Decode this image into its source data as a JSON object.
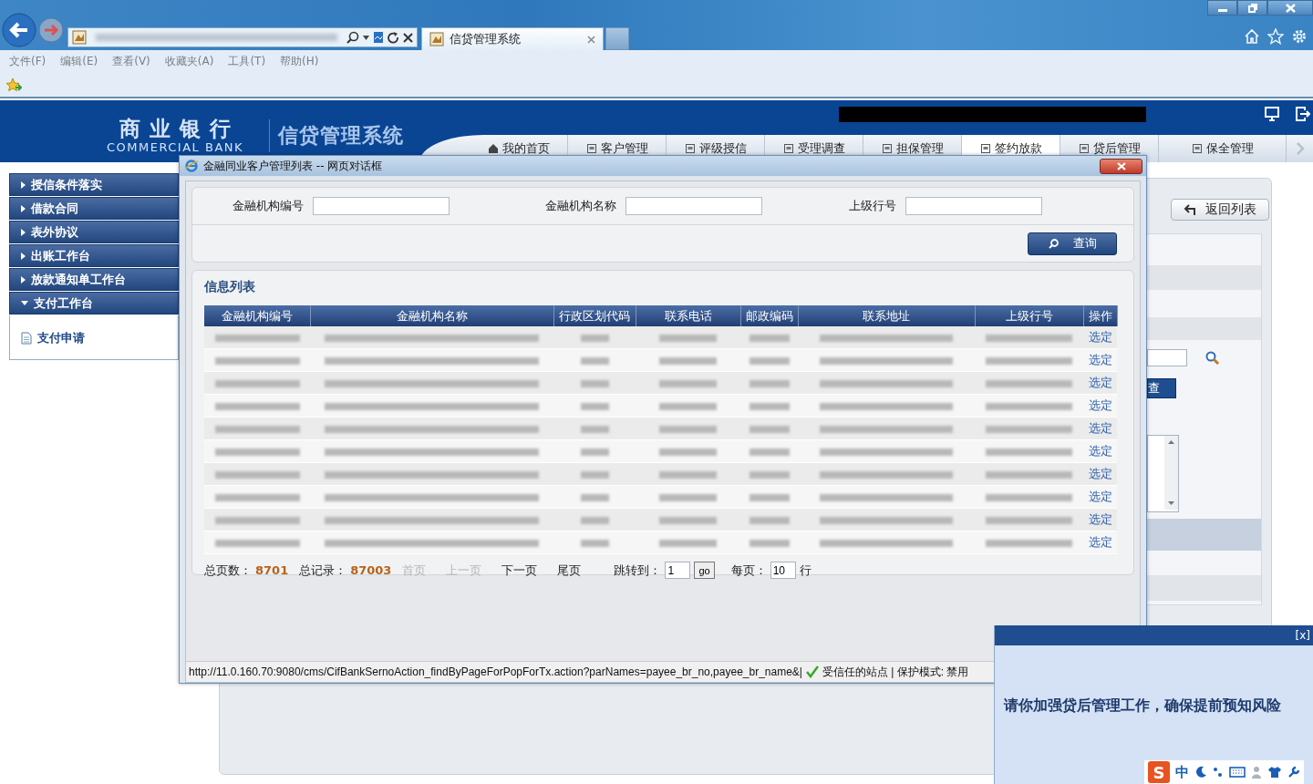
{
  "browser": {
    "tab_title": "信贷管理系统",
    "menu": [
      "文件(F)",
      "编辑(E)",
      "查看(V)",
      "收藏夹(A)",
      "工具(T)",
      "帮助(H)"
    ]
  },
  "app": {
    "logo_cn": "商业银行",
    "logo_en": "COMMERCIAL BANK",
    "system_name": "信贷管理系统",
    "nav": [
      {
        "label": "我的首页",
        "selected": false
      },
      {
        "label": "客户管理",
        "selected": false
      },
      {
        "label": "评级授信",
        "selected": false
      },
      {
        "label": "受理调查",
        "selected": false
      },
      {
        "label": "担保管理",
        "selected": false
      },
      {
        "label": "签约放款",
        "selected": true
      },
      {
        "label": "贷后管理",
        "selected": false
      },
      {
        "label": "保全管理",
        "selected": false
      }
    ]
  },
  "sidebar": {
    "items": [
      {
        "label": "授信条件落实",
        "expanded": false
      },
      {
        "label": "借款合同",
        "expanded": false
      },
      {
        "label": "表外协议",
        "expanded": false
      },
      {
        "label": "出账工作台",
        "expanded": false
      },
      {
        "label": "放款通知单工作台",
        "expanded": false
      },
      {
        "label": "支付工作台",
        "expanded": true,
        "children": [
          {
            "label": "支付申请"
          }
        ]
      }
    ]
  },
  "main": {
    "back_button": "返回列表",
    "query_button": "查"
  },
  "dialog": {
    "title": "金融同业客户管理列表 -- 网页对话框",
    "search_fields": [
      {
        "label": "金融机构编号"
      },
      {
        "label": "金融机构名称"
      },
      {
        "label": "上级行号"
      }
    ],
    "search_button": "查询",
    "list_title": "信息列表",
    "columns": [
      "金融机构编号",
      "金融机构名称",
      "行政区划代码",
      "联系电话",
      "邮政编码",
      "联系地址",
      "上级行号",
      "操作"
    ],
    "rows": [
      {
        "action": "选定"
      },
      {
        "action": "选定"
      },
      {
        "action": "选定"
      },
      {
        "action": "选定"
      },
      {
        "action": "选定"
      },
      {
        "action": "选定"
      },
      {
        "action": "选定"
      },
      {
        "action": "选定"
      },
      {
        "action": "选定"
      },
      {
        "action": "选定"
      }
    ],
    "pager": {
      "total_pages_label": "总页数：",
      "total_pages": "8701",
      "total_records_label": "总记录：",
      "total_records": "87003",
      "links": [
        {
          "label": "首页",
          "disabled": true
        },
        {
          "label": "上一页",
          "disabled": true
        },
        {
          "label": "下一页",
          "disabled": false
        },
        {
          "label": "尾页",
          "disabled": false
        }
      ],
      "jump_label": "跳转到：",
      "page": "1",
      "go": "go",
      "per_page_label": "每页：",
      "per_page": "10",
      "per_page_unit": "行"
    },
    "status_url": "http://11.0.160.70:9080/cms/CifBankSernoAction_findByPageForPopForTx.action?parNames=payee_br_no,payee_br_name&|",
    "status_zone": "受信任的站点 | 保护模式: 禁用"
  },
  "notice": {
    "close": "[x]",
    "message": "请你加强贷后管理工作，确保提前预知风险"
  },
  "ime": {
    "logo": "S",
    "mode": "中"
  }
}
